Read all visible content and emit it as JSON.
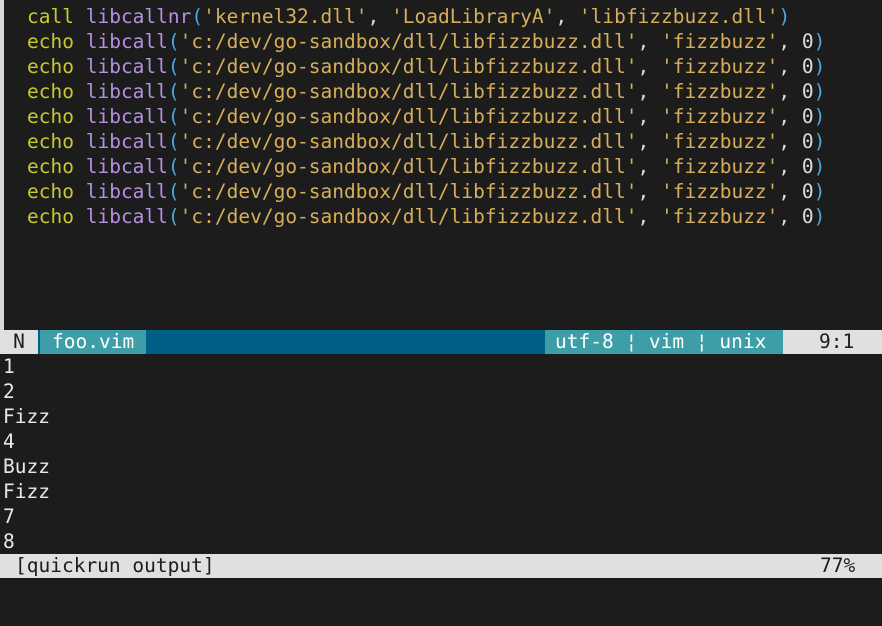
{
  "editor": {
    "lines": [
      {
        "kw": "call",
        "fn": "libcallnr",
        "args": [
          "'kernel32.dll'",
          "'LoadLibraryA'",
          "'libfizzbuzz.dll'"
        ],
        "tail": ""
      },
      {
        "kw": "echo",
        "fn": "libcall",
        "args": [
          "'c:/dev/go-sandbox/dll/libfizzbuzz.dll'",
          "'fizzbuzz'",
          "0"
        ],
        "tail": ""
      },
      {
        "kw": "echo",
        "fn": "libcall",
        "args": [
          "'c:/dev/go-sandbox/dll/libfizzbuzz.dll'",
          "'fizzbuzz'",
          "0"
        ],
        "tail": ""
      },
      {
        "kw": "echo",
        "fn": "libcall",
        "args": [
          "'c:/dev/go-sandbox/dll/libfizzbuzz.dll'",
          "'fizzbuzz'",
          "0"
        ],
        "tail": ""
      },
      {
        "kw": "echo",
        "fn": "libcall",
        "args": [
          "'c:/dev/go-sandbox/dll/libfizzbuzz.dll'",
          "'fizzbuzz'",
          "0"
        ],
        "tail": ""
      },
      {
        "kw": "echo",
        "fn": "libcall",
        "args": [
          "'c:/dev/go-sandbox/dll/libfizzbuzz.dll'",
          "'fizzbuzz'",
          "0"
        ],
        "tail": ""
      },
      {
        "kw": "echo",
        "fn": "libcall",
        "args": [
          "'c:/dev/go-sandbox/dll/libfizzbuzz.dll'",
          "'fizzbuzz'",
          "0"
        ],
        "tail": ""
      },
      {
        "kw": "echo",
        "fn": "libcall",
        "args": [
          "'c:/dev/go-sandbox/dll/libfizzbuzz.dll'",
          "'fizzbuzz'",
          "0"
        ],
        "tail": ""
      },
      {
        "kw": "echo",
        "fn": "libcall",
        "args": [
          "'c:/dev/go-sandbox/dll/libfizzbuzz.dll'",
          "'fizzbuzz'",
          "0"
        ],
        "tail": ""
      }
    ]
  },
  "statusline": {
    "mode": "N",
    "filename": "foo.vim",
    "fileinfo": "utf-8 ¦ vim ¦ unix",
    "position": "9:1"
  },
  "output": {
    "lines": [
      "1",
      "2",
      "Fizz",
      "4",
      "Buzz",
      "Fizz",
      "7",
      "8"
    ]
  },
  "output_statusline": {
    "name": "[quickrun output]",
    "percent": "77%"
  },
  "colors": {
    "keyword": "#c8c830",
    "function": "#b690e0",
    "string": "#d7ae5a",
    "paren": "#47a9df"
  }
}
